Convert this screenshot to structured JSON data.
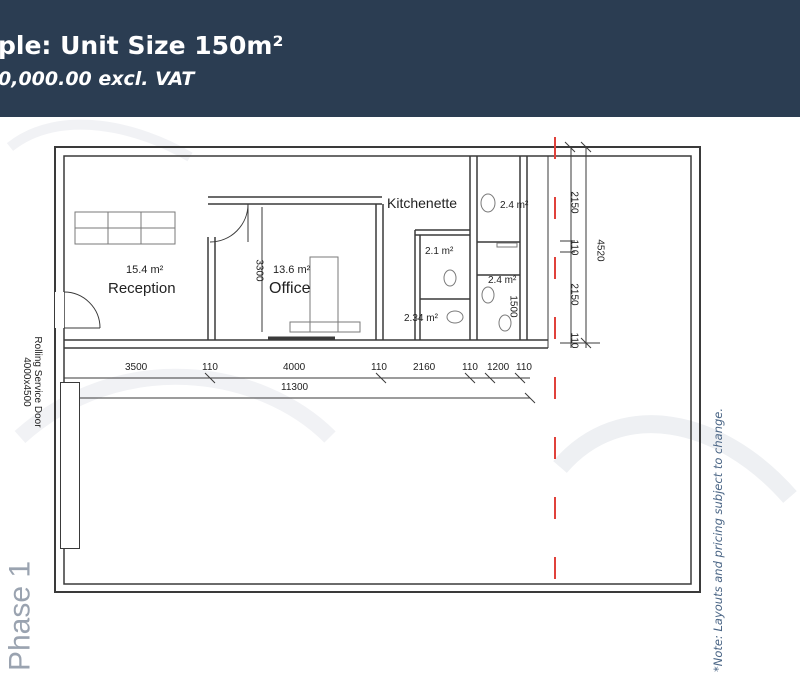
{
  "header": {
    "title": "ple: Unit Size 150m²",
    "subtitle": "0,000.00 excl. VAT"
  },
  "plan": {
    "rooms": {
      "reception_area": "15.4 m²",
      "reception": "Reception",
      "office_area": "13.6 m²",
      "office": "Office",
      "kitchenette": "Kitchenette",
      "wc1_area": "2.4 m²",
      "wc2_area": "2.1 m²",
      "wc3_area": "2.4 m²",
      "wc4_area": "2.34 m²"
    },
    "door_label_1": "Rolling Service Door",
    "door_label_2": "4000x4500",
    "dims": {
      "d3500": "3500",
      "d110a": "110",
      "d4000": "4000",
      "d110b": "110",
      "d2160": "2160",
      "d110c": "110",
      "d1200": "1200",
      "d110d": "110",
      "d11300": "11300",
      "d3300": "3300",
      "d1500": "1500",
      "d2150a": "2150",
      "d110v1": "110",
      "d2150b": "2150",
      "d110v2": "110",
      "d4520": "4520"
    },
    "phase": "Phase 1",
    "note": "*Note: Layouts and pricing subject to change."
  },
  "colors": {
    "header_bg": "#2b3d52",
    "wall": "#3a3a3a",
    "cut_line": "#e0413b",
    "note": "#4a6585"
  }
}
